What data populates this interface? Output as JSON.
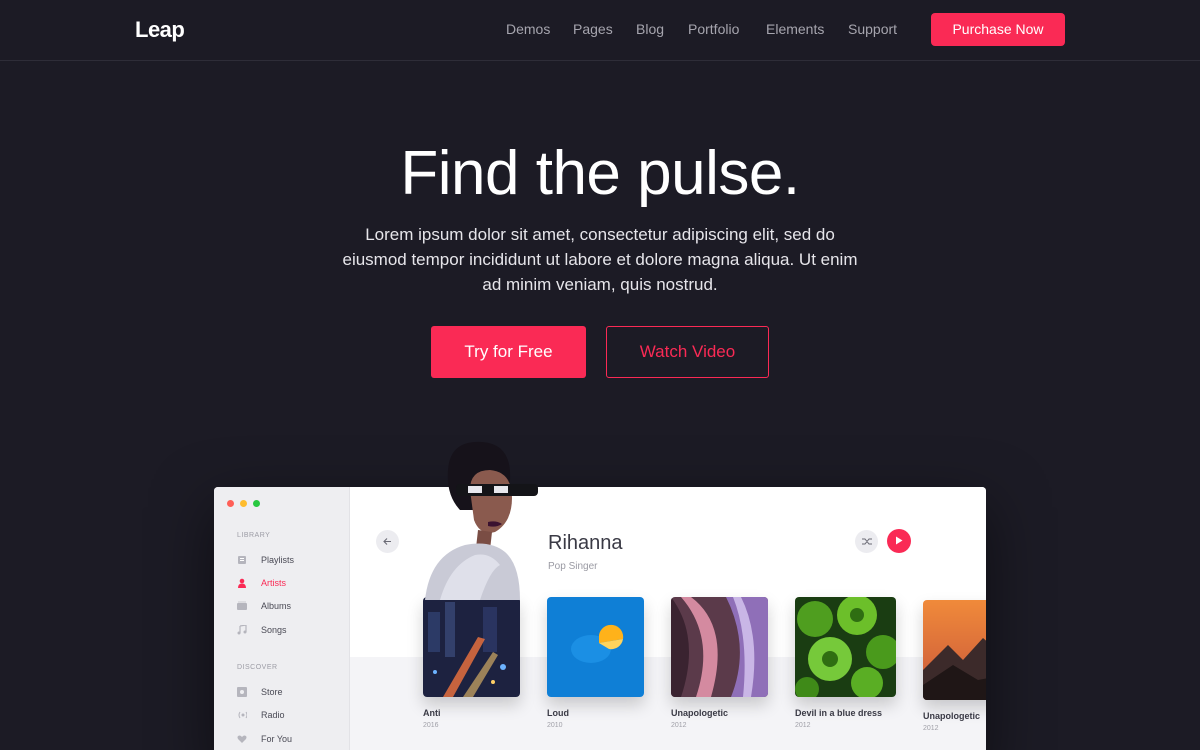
{
  "brand": "Leap",
  "nav": {
    "items": [
      "Demos",
      "Pages",
      "Blog",
      "Portfolio",
      "Elements",
      "Support"
    ],
    "cta": "Purchase Now"
  },
  "hero": {
    "title": "Find the pulse.",
    "text": "Lorem ipsum dolor sit amet, consectetur adipiscing elit, sed do eiusmod tempor incididunt ut labore et dolore magna aliqua. Ut enim ad minim veniam, quis nostrud.",
    "primary_button": "Try for Free",
    "secondary_button": "Watch Video"
  },
  "app": {
    "sidebar": {
      "library_heading": "LIBRARY",
      "library": [
        {
          "label": "Playlists",
          "icon": "playlist-icon"
        },
        {
          "label": "Artists",
          "icon": "person-icon"
        },
        {
          "label": "Albums",
          "icon": "album-icon"
        },
        {
          "label": "Songs",
          "icon": "music-note-icon"
        }
      ],
      "discover_heading": "DISCOVER",
      "discover": [
        {
          "label": "Store",
          "icon": "store-icon"
        },
        {
          "label": "Radio",
          "icon": "radio-icon"
        },
        {
          "label": "For You",
          "icon": "heart-icon"
        }
      ]
    },
    "artist": {
      "name": "Rihanna",
      "subtitle": "Pop Singer"
    },
    "albums": [
      {
        "title": "Anti",
        "year": "2016"
      },
      {
        "title": "Loud",
        "year": "2010"
      },
      {
        "title": "Unapologetic",
        "year": "2012"
      },
      {
        "title": "Devil in a blue dress",
        "year": "2012"
      },
      {
        "title": "Unapologetic",
        "year": "2012"
      }
    ]
  },
  "colors": {
    "accent": "#fa2a55",
    "background": "#1c1b25"
  }
}
